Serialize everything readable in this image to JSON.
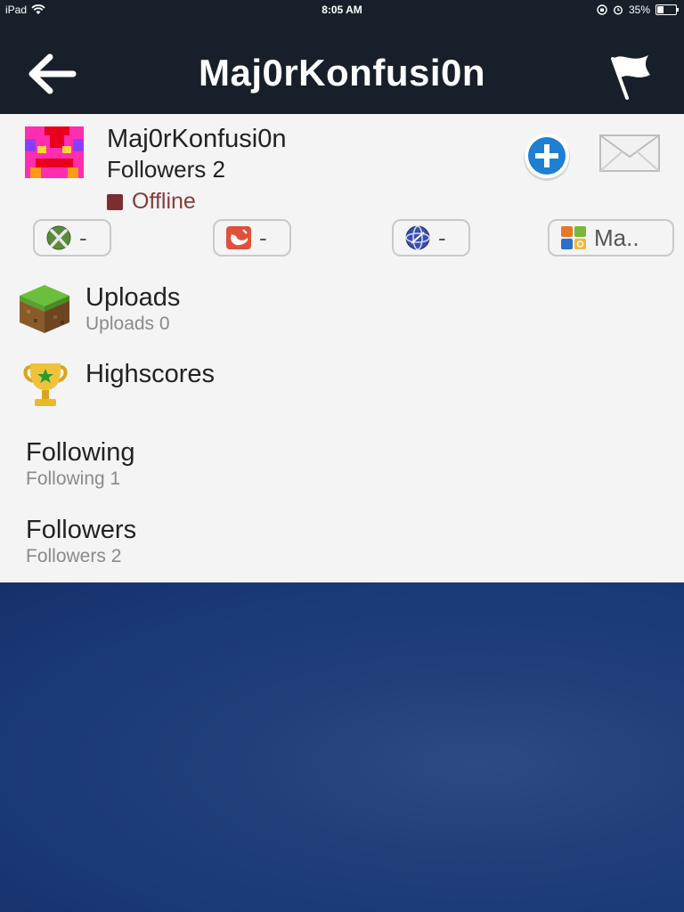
{
  "status_bar": {
    "device": "iPad",
    "time": "8:05 AM",
    "battery": "35%",
    "battery_level": 0.35
  },
  "header": {
    "title": "Maj0rKonfusi0n",
    "back_icon": "arrow-left-icon",
    "flag_icon": "flag-icon"
  },
  "profile": {
    "username": "Maj0rKonfusi0n",
    "followers_line": "Followers 2",
    "status": "Offline",
    "status_color": "#7a2e2e"
  },
  "actions": {
    "follow_icon": "plus-circle-icon",
    "message_icon": "envelope-icon"
  },
  "platforms": [
    {
      "icon": "xbox-icon",
      "label": "-"
    },
    {
      "icon": "game-center-icon",
      "label": "-"
    },
    {
      "icon": "playstation-network-icon",
      "label": "-"
    },
    {
      "icon": "game-center-apps-icon",
      "label": "Ma.."
    }
  ],
  "menu": {
    "uploads": {
      "title": "Uploads",
      "subtitle": "Uploads 0",
      "icon": "grass-block-icon"
    },
    "highscores": {
      "title": "Highscores",
      "icon": "trophy-icon"
    },
    "following": {
      "title": "Following",
      "subtitle": "Following 1"
    },
    "followers": {
      "title": "Followers",
      "subtitle": "Followers 2"
    }
  },
  "colors": {
    "nav_bg": "#17202a",
    "panel_bg": "#f4f4f4",
    "accent_blue": "#1e7fd3",
    "background": "#1d3a78"
  }
}
